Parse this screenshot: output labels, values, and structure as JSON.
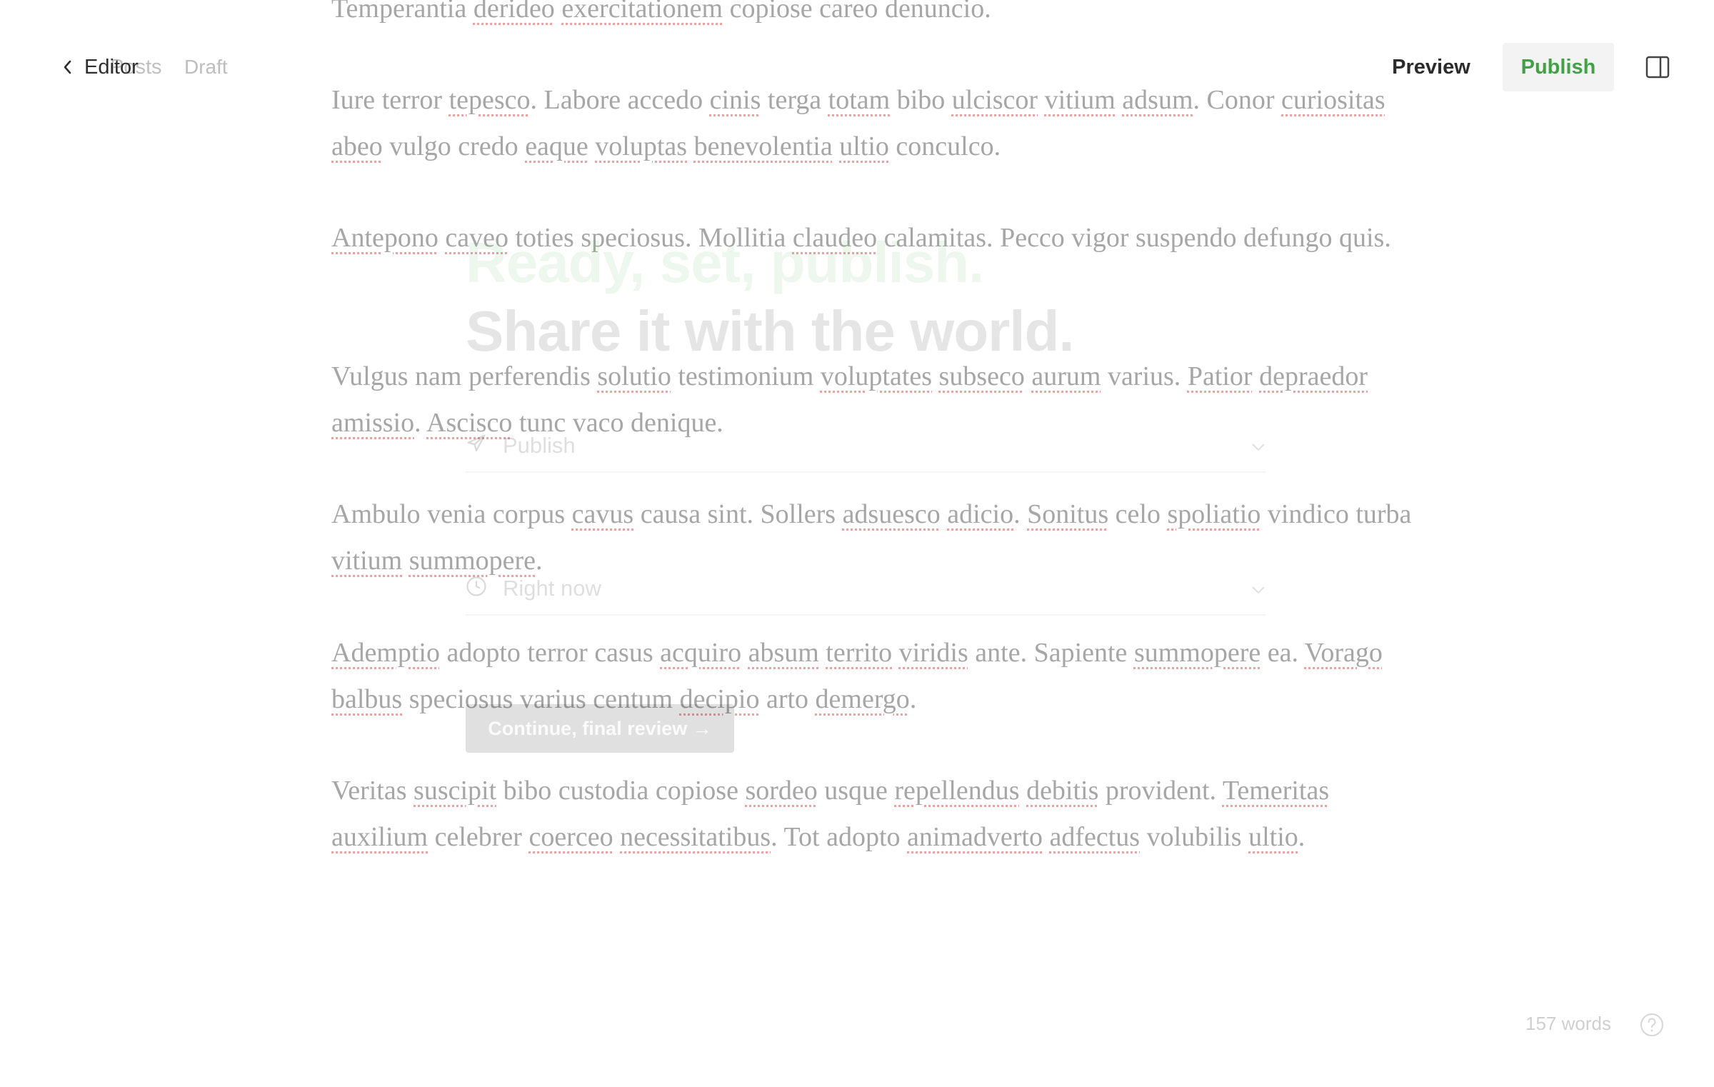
{
  "header": {
    "back_label": "Editor",
    "back_ghost_label": "Posts",
    "status": "Draft",
    "preview_label": "Preview",
    "publish_label": "Publish"
  },
  "editor": {
    "paragraphs": [
      "Temperantia derideo exercitationem copiose careo denuncio.",
      "Iure terror tepesco. Labore accedo cinis terga totam bibo ulciscor vitium adsum. Conor curiositas abeo vulgo credo eaque voluptas benevolentia ultio conculco.",
      "Antepono caveo toties speciosus. Mollitia claudeo calamitas. Pecco vigor suspendo defungo quis.",
      "Vulgus nam perferendis solutio testimonium voluptates subseco aurum varius. Patior depraedor amissio. Ascisco tunc vaco denique.",
      "Ambulo venia corpus cavus causa sint. Sollers adsuesco adicio. Sonitus celo spoliatio vindico turba vitium summopere.",
      "Ademptio adopto terror casus acquiro absum territo viridis ante. Sapiente summopere ea. Vorago balbus speciosus varius centum decipio arto demergo.",
      "Veritas suscipit bibo custodia copiose sordeo usque repellendus debitis provident. Temeritas auxilium celebrer coerceo necessitatibus. Tot adopto animadverto adfectus volubilis ultio."
    ],
    "misspelled": [
      "derideo",
      "exercitationem",
      "tepesco",
      "cinis",
      "totam",
      "ulciscor",
      "vitium",
      "adsum",
      "curiositas",
      "abeo",
      "eaque",
      "voluptas",
      "benevolentia",
      "ultio",
      "Antepono",
      "caveo",
      "claudeo",
      "solutio",
      "voluptates",
      "subseco",
      "aurum",
      "Patior",
      "depraedor",
      "amissio",
      "Ascisco",
      "cavus",
      "adsuesco",
      "adicio",
      "Sonitus",
      "spoliatio",
      "summopere",
      "Ademptio",
      "acquiro",
      "absum",
      "territo",
      "viridis",
      "Vorago",
      "balbus",
      "decipio",
      "demergo",
      "suscipit",
      "sordeo",
      "repellendus",
      "debitis",
      "Temeritas",
      "auxilium",
      "coerceo",
      "necessitatibus",
      "animadverto",
      "adfectus"
    ]
  },
  "publish_overlay": {
    "title_line1": "Ready, set, publish.",
    "title_line2": "Share it with the world.",
    "action_label": "Publish",
    "time_label": "Right now",
    "continue_label": "Continue, final review →"
  },
  "footer": {
    "word_count": "157 words"
  },
  "icons": {
    "back": "chevron-left-icon",
    "sidebar": "sidebar-toggle-icon",
    "help": "help-circle-icon",
    "send": "send-icon",
    "clock": "clock-icon",
    "chevron": "chevron-down-icon"
  },
  "colors": {
    "accent": "#43a047",
    "text_body": "#a6a6a6",
    "spell_underline": "#e9a3a3"
  }
}
